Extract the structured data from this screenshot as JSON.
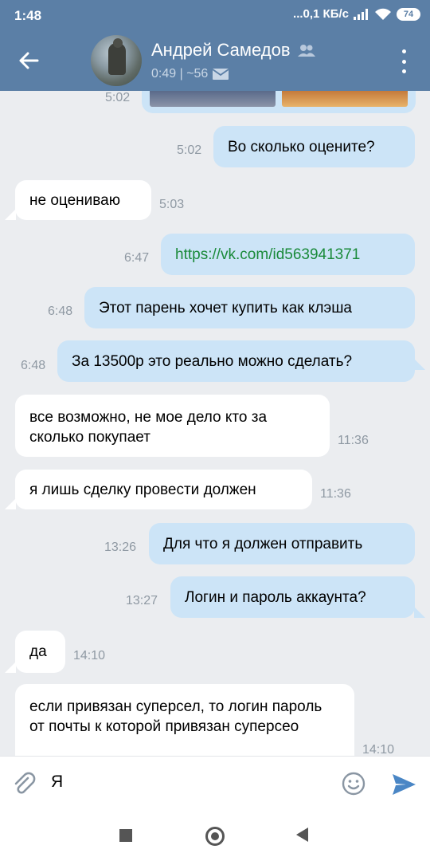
{
  "status": {
    "time": "1:48",
    "network": "...0,1 КБ/с",
    "battery": "74"
  },
  "header": {
    "name": "Андрей Самедов",
    "subtitle": "0:49 | ~56"
  },
  "messages": [
    {
      "dir": "out",
      "time": "5:02",
      "kind": "images"
    },
    {
      "dir": "out",
      "time": "5:02",
      "text": "Во сколько оцените?"
    },
    {
      "dir": "in",
      "time": "5:03",
      "text": "не оцениваю"
    },
    {
      "dir": "out",
      "time": "6:47",
      "text": "https://vk.com/id563941371"
    },
    {
      "dir": "out",
      "time": "6:48",
      "text": "Этот парень хочет купить как клэша"
    },
    {
      "dir": "out",
      "time": "6:48",
      "text": "За 13500р это реально можно сделать?"
    },
    {
      "dir": "in",
      "time": "11:36",
      "text": "все возможно, не мое дело кто за сколько покупает"
    },
    {
      "dir": "in",
      "time": "11:36",
      "text": "я лишь сделку провести должен"
    },
    {
      "dir": "out",
      "time": "13:26",
      "text": "Для что я должен отправить"
    },
    {
      "dir": "out",
      "time": "13:27",
      "text": "Логин и пароль аккаунта?"
    },
    {
      "dir": "in",
      "time": "14:10",
      "text": "да"
    },
    {
      "dir": "in",
      "time": "14:10",
      "text": "если привязан суперсел, то логин пароль от почты к которой привязан суперсео"
    }
  ],
  "input": {
    "value": "Я"
  },
  "colors": {
    "header": "#5b7fa6",
    "background": "#ebedf0",
    "outgoing_bubble": "#cce4f7",
    "incoming_bubble": "#ffffff",
    "link": "#1a8a3a",
    "send": "#4a86c5"
  },
  "icons": [
    "back-arrow-icon",
    "friends-icon",
    "mail-icon",
    "more-vertical-icon",
    "paperclip-icon",
    "emoji-icon",
    "send-icon",
    "recents-icon",
    "home-icon",
    "back-icon"
  ]
}
